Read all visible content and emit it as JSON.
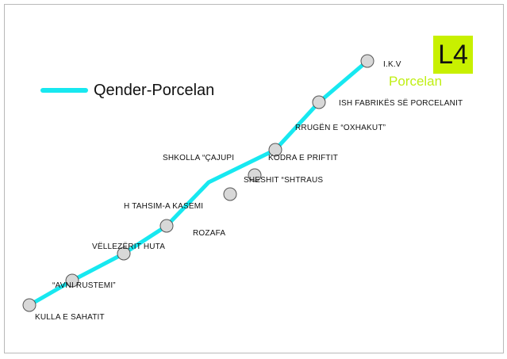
{
  "route": {
    "badge": "L4",
    "legend_label": "Qender-Porcelan",
    "terminus_label": "Porcelan",
    "line_color": "#17e8f0",
    "badge_color": "#c8f000",
    "terminus_color": "#c0ef14",
    "stop_fill": "#d8d8d8",
    "stop_stroke": "#555555"
  },
  "stops": [
    {
      "name": "I.K.V"
    },
    {
      "name": "ISH FABRIKËS SË PORCELANIT"
    },
    {
      "name": "RRUGËN E  “OXHAKUT”"
    },
    {
      "name": "KODRA E PRIFTIT"
    },
    {
      "name": "SHKOLLA “ÇAJUPI"
    },
    {
      "name": "SHESHIT “SHTRAUS"
    },
    {
      "name": "H TAHSIM-A KASEMI"
    },
    {
      "name": "ROZAFA"
    },
    {
      "name": "VËLLEZËRIT HUTA"
    },
    {
      "name": "“AVNI RUSTEMI”"
    },
    {
      "name": "KULLA E SAHATIT"
    }
  ]
}
